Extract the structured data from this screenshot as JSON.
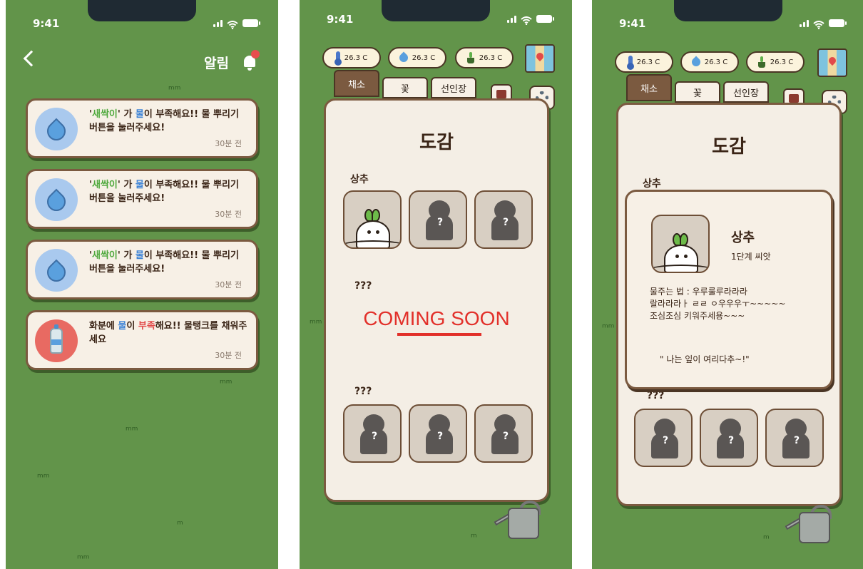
{
  "status": {
    "time": "9:41"
  },
  "notifications_screen": {
    "title": "알림",
    "items": [
      {
        "prefix_quote": "'",
        "plant": "새싹이",
        "mid1": "' 가 ",
        "water": "물",
        "mid2": "이 부족해요!! 물 뿌리기 버튼을 눌러주세요!",
        "time": "30분 전",
        "icon": "water-drop-icon"
      },
      {
        "prefix_quote": "'",
        "plant": "새싹이",
        "mid1": "' 가 ",
        "water": "물",
        "mid2": "이 부족해요!! 물 뿌리기 버튼을 눌러주세요!",
        "time": "30분 전",
        "icon": "water-drop-icon"
      },
      {
        "prefix_quote": "'",
        "plant": "새싹이",
        "mid1": "' 가 ",
        "water": "물",
        "mid2": "이 부족해요!! 물 뿌리기 버튼을 눌러주세요!",
        "time": "30분 전",
        "icon": "water-drop-icon"
      },
      {
        "pre": "화분에 ",
        "water": "물",
        "mid": "이 ",
        "warn": "부족",
        "post": "해요!! 물탱크를 채워주세요",
        "time": "30분 전",
        "icon": "water-bottle-icon"
      }
    ]
  },
  "sensors": {
    "temperature": "26.3 C",
    "humidity": "26.3 C",
    "soil": "26.3 C"
  },
  "tabs": {
    "veg": "채소",
    "flower": "꽃",
    "cactus": "선인장"
  },
  "collection": {
    "title": "도감",
    "section1": "상추",
    "section2": "???",
    "section3": "???",
    "coming_soon": "COMING SOON",
    "unknown_mark": "?"
  },
  "detail_popup": {
    "name": "상추",
    "stage": "1단계 씨앗",
    "desc_line1": "물주는 법 : 우루룰루라라라",
    "desc_line2": "랄라라라ㅏ ㄹㄹ ㅇ우우우ㅜ~~~~~",
    "desc_line3": "조심조심 키워주세용~~~",
    "quote": "\" 나는 잎이 여리다추~!\""
  },
  "colors": {
    "grass": "#62944a",
    "card": "#f7f0e6",
    "border": "#7b5a40",
    "coming": "#e2302a"
  }
}
